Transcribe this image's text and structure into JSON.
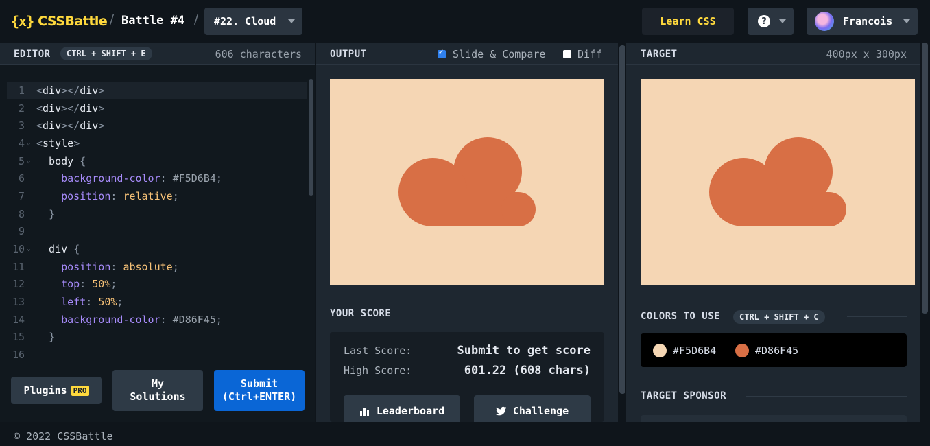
{
  "header": {
    "logo_mark": "{x}",
    "logo_text": "CSSBattle",
    "separator": "/",
    "battle_label": "Battle #4",
    "challenge_label": "#22. Cloud",
    "learn_label": "Learn CSS",
    "help_label": "?",
    "user_name": "Francois"
  },
  "editor": {
    "title": "EDITOR",
    "shortcut": "CTRL + SHIFT + E",
    "char_count": "606 characters",
    "lines": [
      {
        "n": "1",
        "fold": "",
        "parts": [
          [
            "punc",
            "<"
          ],
          [
            "tag",
            "div"
          ],
          [
            "punc",
            "></"
          ],
          [
            "tag",
            "div"
          ],
          [
            "punc",
            ">"
          ]
        ]
      },
      {
        "n": "2",
        "fold": "",
        "parts": [
          [
            "punc",
            "<"
          ],
          [
            "tag",
            "div"
          ],
          [
            "punc",
            "></"
          ],
          [
            "tag",
            "div"
          ],
          [
            "punc",
            ">"
          ]
        ]
      },
      {
        "n": "3",
        "fold": "",
        "parts": [
          [
            "punc",
            "<"
          ],
          [
            "tag",
            "div"
          ],
          [
            "punc",
            "></"
          ],
          [
            "tag",
            "div"
          ],
          [
            "punc",
            ">"
          ]
        ]
      },
      {
        "n": "4",
        "fold": "v",
        "parts": [
          [
            "punc",
            "<"
          ],
          [
            "tag",
            "style"
          ],
          [
            "punc",
            ">"
          ]
        ]
      },
      {
        "n": "5",
        "fold": "v",
        "parts": [
          [
            "sel",
            "  body "
          ],
          [
            "punc",
            "{"
          ]
        ]
      },
      {
        "n": "6",
        "fold": "",
        "parts": [
          [
            "sel",
            "    "
          ],
          [
            "prop",
            "background-color"
          ],
          [
            "punc",
            ": "
          ],
          [
            "hex",
            "#F5D6B4"
          ],
          [
            "punc",
            ";"
          ]
        ]
      },
      {
        "n": "7",
        "fold": "",
        "parts": [
          [
            "sel",
            "    "
          ],
          [
            "prop",
            "position"
          ],
          [
            "punc",
            ": "
          ],
          [
            "val",
            "relative"
          ],
          [
            "punc",
            ";"
          ]
        ]
      },
      {
        "n": "8",
        "fold": "",
        "parts": [
          [
            "sel",
            "  "
          ],
          [
            "punc",
            "}"
          ]
        ]
      },
      {
        "n": "9",
        "fold": "",
        "parts": []
      },
      {
        "n": "10",
        "fold": "v",
        "parts": [
          [
            "sel",
            "  div "
          ],
          [
            "punc",
            "{"
          ]
        ]
      },
      {
        "n": "11",
        "fold": "",
        "parts": [
          [
            "sel",
            "    "
          ],
          [
            "prop",
            "position"
          ],
          [
            "punc",
            ": "
          ],
          [
            "val",
            "absolute"
          ],
          [
            "punc",
            ";"
          ]
        ]
      },
      {
        "n": "12",
        "fold": "",
        "parts": [
          [
            "sel",
            "    "
          ],
          [
            "prop",
            "top"
          ],
          [
            "punc",
            ": "
          ],
          [
            "num",
            "50"
          ],
          [
            "val",
            "%"
          ],
          [
            "punc",
            ";"
          ]
        ]
      },
      {
        "n": "13",
        "fold": "",
        "parts": [
          [
            "sel",
            "    "
          ],
          [
            "prop",
            "left"
          ],
          [
            "punc",
            ": "
          ],
          [
            "num",
            "50"
          ],
          [
            "val",
            "%"
          ],
          [
            "punc",
            ";"
          ]
        ]
      },
      {
        "n": "14",
        "fold": "",
        "parts": [
          [
            "sel",
            "    "
          ],
          [
            "prop",
            "background-color"
          ],
          [
            "punc",
            ": "
          ],
          [
            "hex",
            "#D86F45"
          ],
          [
            "punc",
            ";"
          ]
        ]
      },
      {
        "n": "15",
        "fold": "",
        "parts": [
          [
            "sel",
            "  "
          ],
          [
            "punc",
            "}"
          ]
        ]
      },
      {
        "n": "16",
        "fold": "",
        "parts": []
      }
    ],
    "plugins_label": "Plugins",
    "pro_label": "PRO",
    "solutions_label": "My\nSolutions",
    "submit_label": "Submit\n(Ctrl+ENTER)"
  },
  "output": {
    "title": "OUTPUT",
    "slide_label": "Slide & Compare",
    "slide_checked": true,
    "diff_label": "Diff",
    "diff_checked": false
  },
  "score": {
    "title": "YOUR SCORE",
    "last_label": "Last Score:",
    "last_value": "Submit to get score",
    "high_label": "High Score:",
    "high_value": "601.22 (608 chars)",
    "leaderboard_label": "Leaderboard",
    "challenge_label": "Challenge"
  },
  "target": {
    "title": "TARGET",
    "size": "400px x 300px",
    "colors_title": "COLORS TO USE",
    "colors_shortcut": "CTRL + SHIFT + C",
    "colors": [
      {
        "hex": "#F5D6B4",
        "label": "#F5D6B4"
      },
      {
        "hex": "#D86F45",
        "label": "#D86F45"
      }
    ],
    "sponsor_title": "TARGET SPONSOR"
  },
  "colors": {
    "background": "#F5D6B4",
    "cloud": "#D86F45",
    "accent_yellow": "#FFD93D",
    "submit_blue": "#0A66D6"
  },
  "footer": {
    "copyright": "© 2022 CSSBattle"
  }
}
